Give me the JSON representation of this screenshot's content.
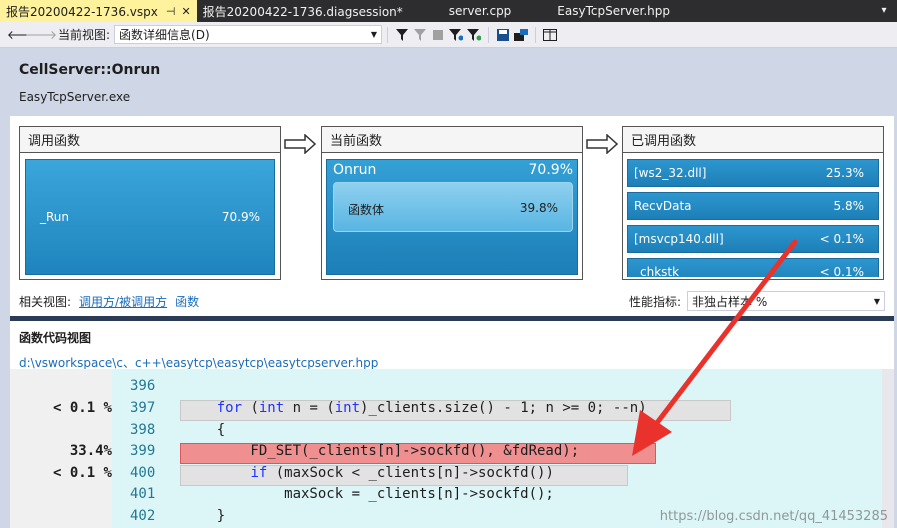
{
  "tabs": [
    {
      "label": "报告20200422-1736.vspx",
      "active": true,
      "pin": "⊣",
      "close": "✕"
    },
    {
      "label": "报告20200422-1736.diagsession*",
      "active": false
    },
    {
      "label": "server.cpp",
      "active": false
    },
    {
      "label": "EasyTcpServer.hpp",
      "active": false
    }
  ],
  "toolbar": {
    "view_label": "当前视图:",
    "view_value": "函数详细信息(D)"
  },
  "header": {
    "function": "CellServer::Onrun",
    "module": "EasyTcpServer.exe"
  },
  "callers": {
    "title": "调用函数",
    "items": [
      {
        "name": "_Run",
        "pct": "70.9%"
      }
    ]
  },
  "current": {
    "title": "当前函数",
    "name": "Onrun",
    "pct": "70.9%",
    "body_label": "函数体",
    "body_pct": "39.8%"
  },
  "callees": {
    "title": "已调用函数",
    "items": [
      {
        "name": "[ws2_32.dll]",
        "pct": "25.3%"
      },
      {
        "name": "RecvData",
        "pct": "5.8%"
      },
      {
        "name": "[msvcp140.dll]",
        "pct": "< 0.1%"
      },
      {
        "name": "_chkstk",
        "pct": "< 0.1%"
      }
    ]
  },
  "related": {
    "label": "相关视图:",
    "link1": "调用方/被调用方",
    "link2": "函数"
  },
  "metric": {
    "label": "性能指标:",
    "value": "非独占样本 %"
  },
  "code_view": {
    "title": "函数代码视图",
    "path": "d:\\vsworkspace\\c、c++\\easytcp\\easytcp\\easytcpserver.hpp"
  },
  "code_lines": [
    {
      "ln": "396",
      "metric": "",
      "src": ""
    },
    {
      "ln": "397",
      "metric": "< 0.1 %",
      "src": "    for (int n = (int)_clients.size() - 1; n >= 0; --n)"
    },
    {
      "ln": "398",
      "metric": "",
      "src": "    {"
    },
    {
      "ln": "399",
      "metric": "33.4%",
      "src": "        FD_SET(_clients[n]->sockfd(), &fdRead);"
    },
    {
      "ln": "400",
      "metric": "< 0.1 %",
      "src": "        if (maxSock < _clients[n]->sockfd())"
    },
    {
      "ln": "401",
      "metric": "",
      "src": "            maxSock = _clients[n]->sockfd();"
    },
    {
      "ln": "402",
      "metric": "",
      "src": "    }"
    }
  ],
  "watermark": "https://blog.csdn.net/qq_41453285",
  "colors": {
    "highlight_red": "#ef8f8f",
    "annotation_arrow": "#e8322b",
    "accent_blue": "#1f84bd"
  }
}
